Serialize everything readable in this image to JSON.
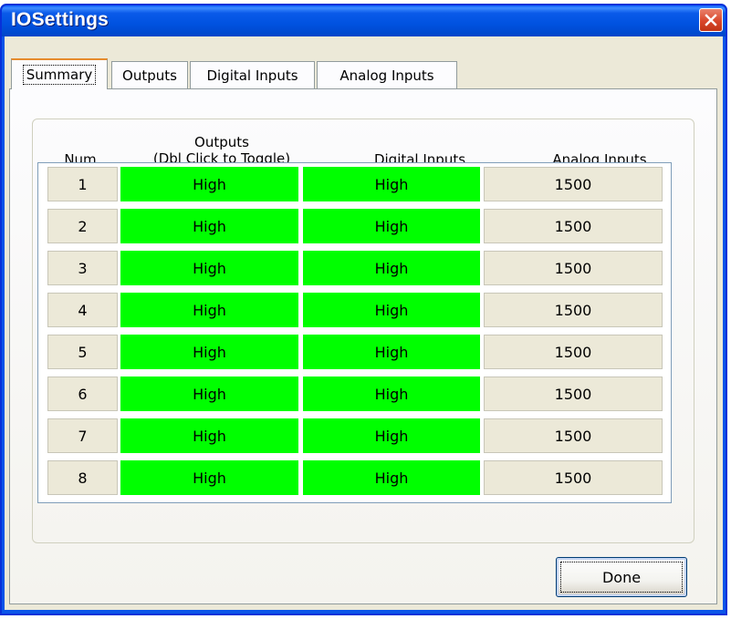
{
  "window": {
    "title": "IOSettings"
  },
  "tabs": [
    {
      "label": "Summary",
      "active": true
    },
    {
      "label": "Outputs",
      "active": false
    },
    {
      "label": "Digital Inputs",
      "active": false
    },
    {
      "label": "Analog Inputs",
      "active": false
    }
  ],
  "headers": {
    "num": "Num",
    "outputs_line1": "Outputs",
    "outputs_line2": "(Dbl Click to Toggle)",
    "digital_inputs": "Digital Inputs",
    "analog_inputs": "Analog Inputs"
  },
  "rows": [
    {
      "num": "1",
      "output": "High",
      "digital": "High",
      "analog": "1500"
    },
    {
      "num": "2",
      "output": "High",
      "digital": "High",
      "analog": "1500"
    },
    {
      "num": "3",
      "output": "High",
      "digital": "High",
      "analog": "1500"
    },
    {
      "num": "4",
      "output": "High",
      "digital": "High",
      "analog": "1500"
    },
    {
      "num": "5",
      "output": "High",
      "digital": "High",
      "analog": "1500"
    },
    {
      "num": "6",
      "output": "High",
      "digital": "High",
      "analog": "1500"
    },
    {
      "num": "7",
      "output": "High",
      "digital": "High",
      "analog": "1500"
    },
    {
      "num": "8",
      "output": "High",
      "digital": "High",
      "analog": "1500"
    }
  ],
  "buttons": {
    "done_label": "Done"
  },
  "colors": {
    "high_state": "#00ff00",
    "titlebar": "#0052e0",
    "close_button": "#d9462a",
    "dialog_face": "#ece9d8"
  },
  "icons": {
    "close": "close-icon"
  }
}
